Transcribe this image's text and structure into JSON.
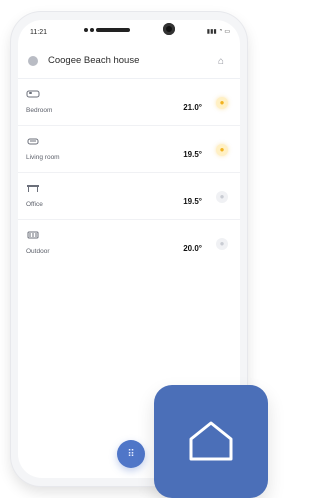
{
  "status": {
    "time": "11:21"
  },
  "header": {
    "title": "Coogee Beach house"
  },
  "rooms": [
    {
      "name": "Bedroom",
      "temp": "21.0°",
      "light": "on"
    },
    {
      "name": "Living room",
      "temp": "19.5°",
      "light": "on"
    },
    {
      "name": "Office",
      "temp": "19.5°",
      "light": "off"
    },
    {
      "name": "Outdoor",
      "temp": "20.0°",
      "light": "off"
    }
  ],
  "colors": {
    "accent": "#4f76c8",
    "badge": "#4b6fb8",
    "light_on": "#f1b21f",
    "light_off": "#c9ccd3"
  },
  "icons": {
    "header_left": "avatar-icon",
    "header_right": "settings-icon",
    "room_icons": [
      "bed-icon",
      "sofa-icon",
      "desk-icon",
      "outdoor-icon"
    ],
    "badge": "home-icon"
  }
}
